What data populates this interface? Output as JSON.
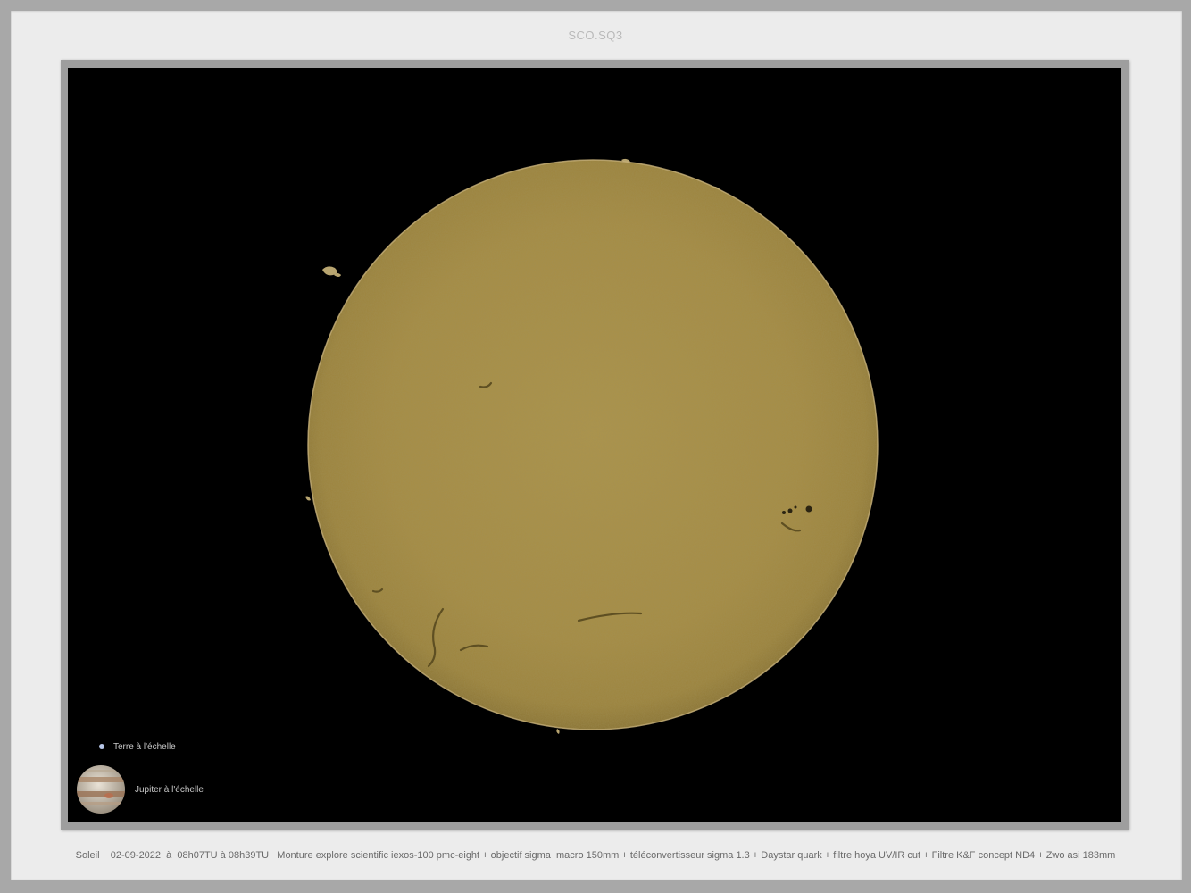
{
  "header": {
    "title": "SCO.SQ3"
  },
  "scale_legend": {
    "earth_label": "Terre à l'échelle",
    "jupiter_label": "Jupiter à l'échelle"
  },
  "caption": {
    "text": "Soleil    02-09-2022  à  08h07TU à 08h39TU   Monture explore scientific iexos-100 pmc-eight + objectif sigma  macro 150mm + téléconvertisseur sigma 1.3 + Daystar quark + filtre hoya UV/IR cut + Filtre K&F concept ND4 + Zwo asi 183mm"
  },
  "colors": {
    "sun_disk": "#a88f45",
    "sky": "#000000",
    "mat": "#ececec",
    "frame": "#a8a8a8"
  }
}
